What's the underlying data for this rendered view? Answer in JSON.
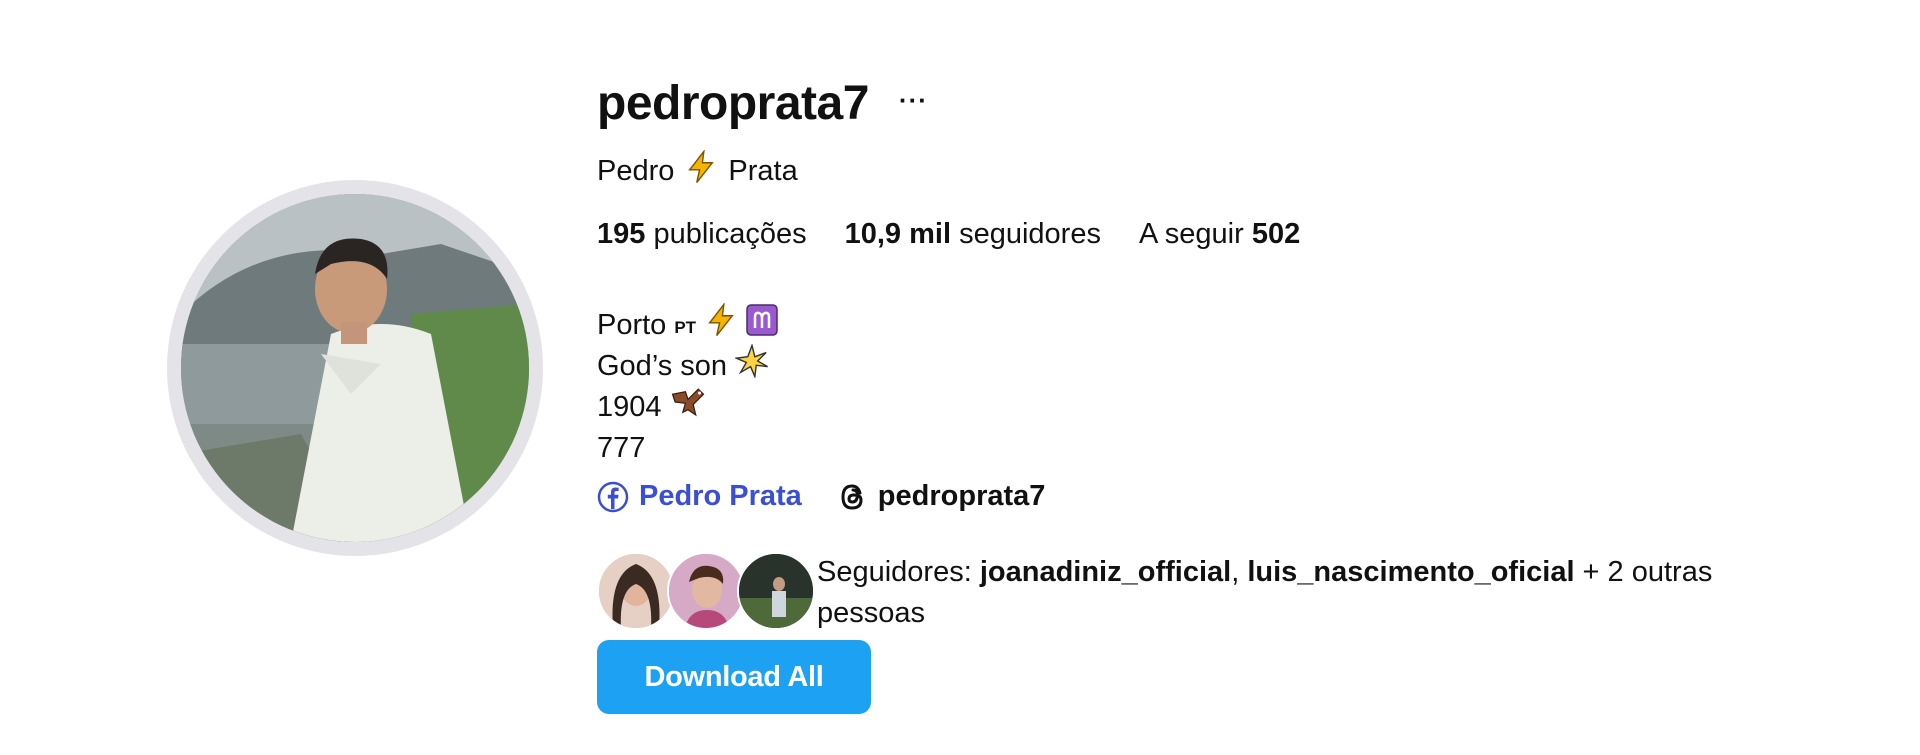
{
  "profile": {
    "username": "pedroprata7",
    "more_label": "···",
    "first_name": "Pedro",
    "last_name": "Prata"
  },
  "stats": {
    "posts_count": "195",
    "posts_label": "publicações",
    "followers_count": "10,9 mil",
    "followers_label": "seguidores",
    "following_label": "A seguir",
    "following_count": "502"
  },
  "bio": {
    "line1_text": "Porto",
    "line1_flag": "PT",
    "line2_text": "God’s son",
    "line3_text": "1904",
    "line4_text": "777"
  },
  "links": {
    "facebook_label": "Pedro Prata",
    "threads_label": "pedroprata7"
  },
  "followed_by": {
    "prefix": "Seguidores: ",
    "user1": "joanadiniz_official",
    "separator": ", ",
    "user2": "luis_nascimento_oficial",
    "suffix": " + 2 outras pessoas"
  },
  "actions": {
    "download_label": "Download All"
  },
  "colors": {
    "link_blue": "#3a4fd1",
    "button_blue": "#1da1f2",
    "lightning": "#f4b400",
    "aries_purple": "#9b59d0"
  },
  "icons": [
    "more-icon",
    "lightning-emoji-icon",
    "aries-emoji-icon",
    "sparkle-emoji-icon",
    "eagle-emoji-icon",
    "facebook-icon",
    "threads-icon"
  ]
}
